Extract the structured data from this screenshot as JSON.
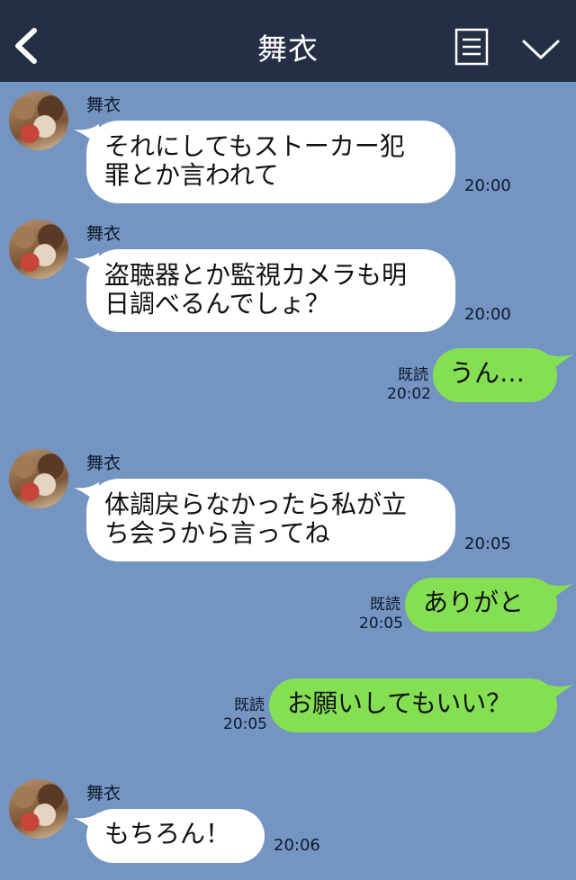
{
  "header": {
    "title": "舞衣"
  },
  "messages": [
    {
      "sender": "舞衣",
      "text": "それにしてもストーカー犯\n罪とか言われて",
      "time": "20:00"
    },
    {
      "sender": "舞衣",
      "text": "盗聴器とか監視カメラも明\n日調べるんでしょ？",
      "time": "20:00"
    },
    {
      "read": "既読",
      "text": "うん…",
      "time": "20:02"
    },
    {
      "sender": "舞衣",
      "text": "体調戻らなかったら私が立\nち会うから言ってね",
      "time": "20:05"
    },
    {
      "read": "既読",
      "text": "ありがと",
      "time": "20:05"
    },
    {
      "read": "既読",
      "text": "お願いしてもいい？",
      "time": "20:05"
    },
    {
      "sender": "舞衣",
      "text": "もちろん！",
      "time": "20:06"
    }
  ],
  "colors": {
    "header": "#242f45",
    "background": "#7494c2",
    "sent_bubble": "#84e052",
    "received_bubble": "#ffffff"
  },
  "icons": [
    "back-chevron-icon",
    "menu-list-icon",
    "chevron-down-icon"
  ]
}
